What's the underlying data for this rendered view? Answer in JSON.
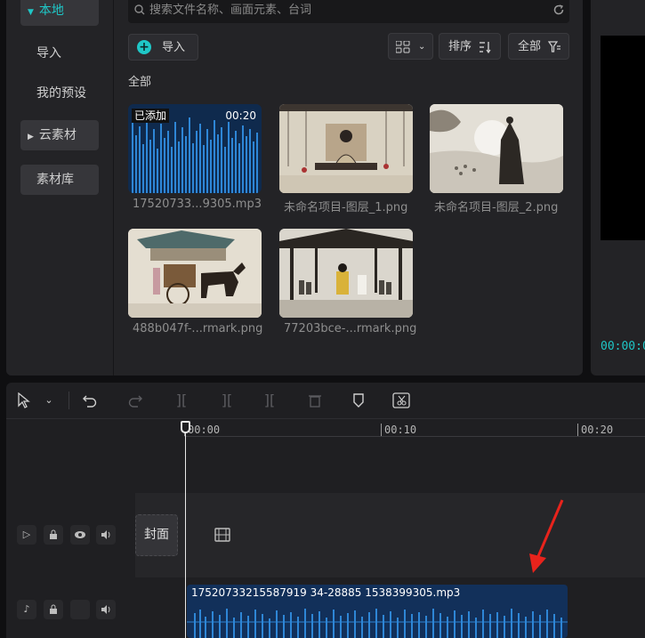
{
  "sidebar": {
    "items": [
      {
        "label": "本地",
        "expanded": true
      },
      {
        "label": "导入"
      },
      {
        "label": "我的预设"
      },
      {
        "label": "云素材",
        "expanded": false
      },
      {
        "label": "素材库"
      }
    ]
  },
  "search": {
    "placeholder": "搜索文件名称、画面元素、台词"
  },
  "toolbar": {
    "import_label": "导入",
    "sort_label": "排序",
    "filter_label": "全部"
  },
  "section_title": "全部",
  "media": [
    {
      "name": "17520733...9305.mp3",
      "badge": "已添加",
      "duration": "00:20",
      "type": "audio"
    },
    {
      "name": "未命名项目-图层_1.png",
      "type": "image"
    },
    {
      "name": "未命名项目-图层_2.png",
      "type": "image"
    },
    {
      "name": "488b047f-...rmark.png",
      "type": "image"
    },
    {
      "name": "77203bce-...rmark.png",
      "type": "image"
    }
  ],
  "preview": {
    "timecode": "00:00:0"
  },
  "timeline": {
    "ruler_labels": [
      "00:00",
      "00:10",
      "00:20"
    ],
    "cover_label": "封面",
    "audio_clip_name": "17520733215587919 34-28885 1538399305.mp3"
  },
  "colors": {
    "accent": "#1fc7c7",
    "audio_clip": "#12305a",
    "waveform": "#2e86d6",
    "annotation_arrow": "#e8231c"
  }
}
